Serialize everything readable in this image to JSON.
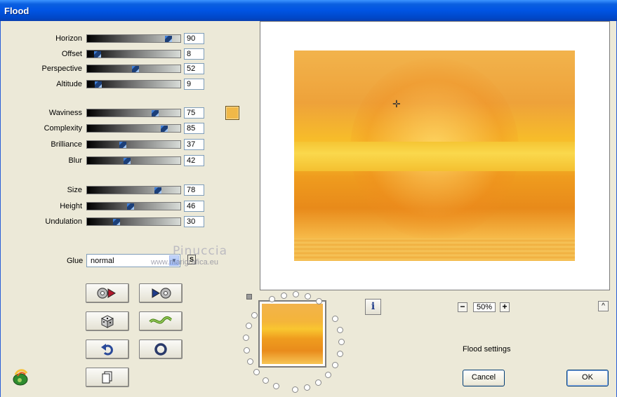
{
  "window": {
    "title": "Flood"
  },
  "sliders_group1": [
    {
      "label": "Horizon",
      "value": "90",
      "level": 0.9
    },
    {
      "label": "Offset",
      "value": "8",
      "level": 0.08
    },
    {
      "label": "Perspective",
      "value": "52",
      "level": 0.52
    },
    {
      "label": "Altitude",
      "value": "9",
      "level": 0.09
    }
  ],
  "sliders_group2": [
    {
      "label": "Waviness",
      "value": "75",
      "level": 0.75
    },
    {
      "label": "Complexity",
      "value": "85",
      "level": 0.85
    },
    {
      "label": "Brilliance",
      "value": "37",
      "level": 0.37
    },
    {
      "label": "Blur",
      "value": "42",
      "level": 0.42
    }
  ],
  "sliders_group3": [
    {
      "label": "Size",
      "value": "78",
      "level": 0.78
    },
    {
      "label": "Height",
      "value": "46",
      "level": 0.46
    },
    {
      "label": "Undulation",
      "value": "30",
      "level": 0.3
    }
  ],
  "color_swatch": {
    "color": "#f0b848"
  },
  "glue": {
    "label": "Glue",
    "value": "normal",
    "s_button": "S"
  },
  "watermark": {
    "line1": "Pinuccia",
    "line2": "www.marigrafica.eu"
  },
  "buttons": {
    "icons": [
      "reset-to-start-icon",
      "play-preset-icon",
      "random-dice-icon",
      "wave-icon",
      "undo-icon",
      "stop-icon",
      "copy-icon"
    ]
  },
  "preview": {
    "zoom": "50%",
    "info": "i",
    "caret": "^",
    "minus": "−",
    "plus": "+"
  },
  "status": {
    "text": "Flood settings"
  },
  "dialog_buttons": {
    "cancel": "Cancel",
    "ok": "OK"
  }
}
